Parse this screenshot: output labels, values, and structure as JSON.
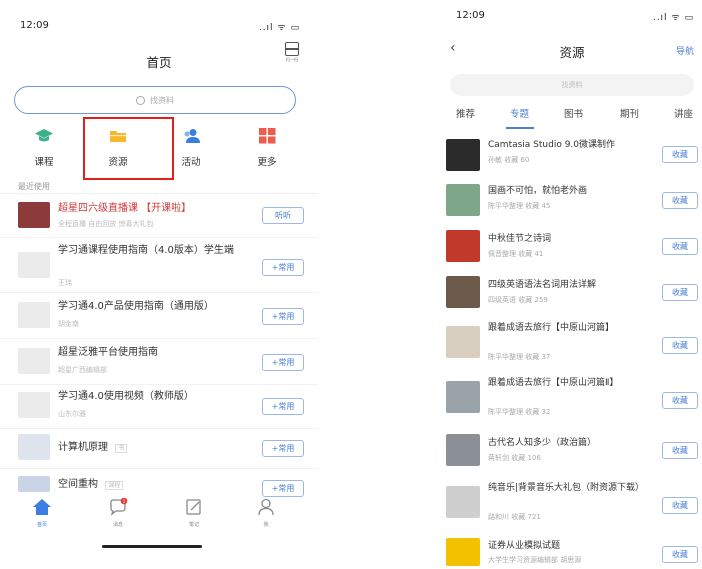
{
  "left": {
    "status": {
      "time": "12:09",
      "signal": "..ıl ᯤ ▭"
    },
    "title": "首页",
    "scan_label": "扫一扫",
    "search_placeholder": "找资料",
    "quick": [
      {
        "label": "课程",
        "icon": "graduation-cap-icon",
        "color": "#3cb08a"
      },
      {
        "label": "资源",
        "icon": "folder-icon",
        "color": "#f5b92e"
      },
      {
        "label": "活动",
        "icon": "people-icon",
        "color": "#3b7de0"
      },
      {
        "label": "更多",
        "icon": "grid-icon",
        "color": "#ef5b4c"
      }
    ],
    "section": "最近使用",
    "recent": [
      {
        "title": "超星四六级直播课 【开课啦】",
        "sub": "全程直播 自由回放 惊喜大礼包",
        "button": "听听",
        "highlight": true
      },
      {
        "title": "学习通课程使用指南（4.0版本）学生端",
        "sub": "王玮",
        "button": "+常用"
      },
      {
        "title": "学习通4.0产品使用指南（通用版）",
        "sub": "胡金南",
        "button": "+常用"
      },
      {
        "title": "超星泛雅平台使用指南",
        "sub": "超星广西编辑部",
        "button": "+常用"
      },
      {
        "title": "学习通4.0使用视频（教师版）",
        "sub": "山东尔雅",
        "button": "+常用"
      },
      {
        "title": "计算机原理",
        "badge": "书",
        "button": "+常用"
      },
      {
        "title": "空间重构",
        "badge": "课程",
        "button": "+常用"
      }
    ],
    "tabbar": [
      {
        "label": "首页",
        "icon": "home-icon",
        "active": true
      },
      {
        "label": "消息",
        "icon": "chat-bubble-icon",
        "badge": "1"
      },
      {
        "label": "笔记",
        "icon": "note-edit-icon"
      },
      {
        "label": "我",
        "icon": "user-icon"
      }
    ]
  },
  "right": {
    "status": {
      "time": "12:09",
      "signal": "..ıl ᯤ ▭"
    },
    "back": "‹",
    "title": "资源",
    "nav_link": "导航",
    "search_placeholder": "找资料",
    "tabs": [
      "推荐",
      "专题",
      "图书",
      "期刊",
      "讲座"
    ],
    "active_tab": 1,
    "items": [
      {
        "title": "Camtasia Studio 9.0微课制作",
        "sub": "孙敏  收藏 60",
        "fav": "收藏",
        "thumb": "#2b2b2b"
      },
      {
        "title": "国画不可怕，就怕老外画",
        "sub": "陈平华整理  收藏 45",
        "fav": "收藏",
        "thumb": "#7fa88a"
      },
      {
        "title": "中秋佳节之诗词",
        "sub": "佩音整理  收藏 41",
        "fav": "收藏",
        "thumb": "#c0392b"
      },
      {
        "title": "四级英语语法名词用法详解",
        "sub": "四级英语  收藏 259",
        "fav": "收藏",
        "thumb": "#6b5a4a"
      },
      {
        "title": "跟着成语去旅行【中原山河篇】",
        "sub": "陈平华整理  收藏 37",
        "fav": "收藏",
        "thumb": "#d9cfc0"
      },
      {
        "title": "跟着成语去旅行【中原山河篇Ⅱ】",
        "sub": "陈平华整理  收藏 32",
        "fav": "收藏",
        "thumb": "#9aa3a8"
      },
      {
        "title": "古代名人知多少（政治篇）",
        "sub": "蒋轩剑  收藏 106",
        "fav": "收藏",
        "thumb": "#8a9096"
      },
      {
        "title": "纯音乐|背景音乐大礼包（附资源下载）",
        "sub": "路和川  收藏 721",
        "fav": "收藏",
        "thumb": "#cfcfcf"
      },
      {
        "title": "证券从业模拟试题",
        "sub": "大学生学习资源编辑部  胡思源",
        "fav": "收藏",
        "thumb": "#f2c200"
      }
    ]
  }
}
